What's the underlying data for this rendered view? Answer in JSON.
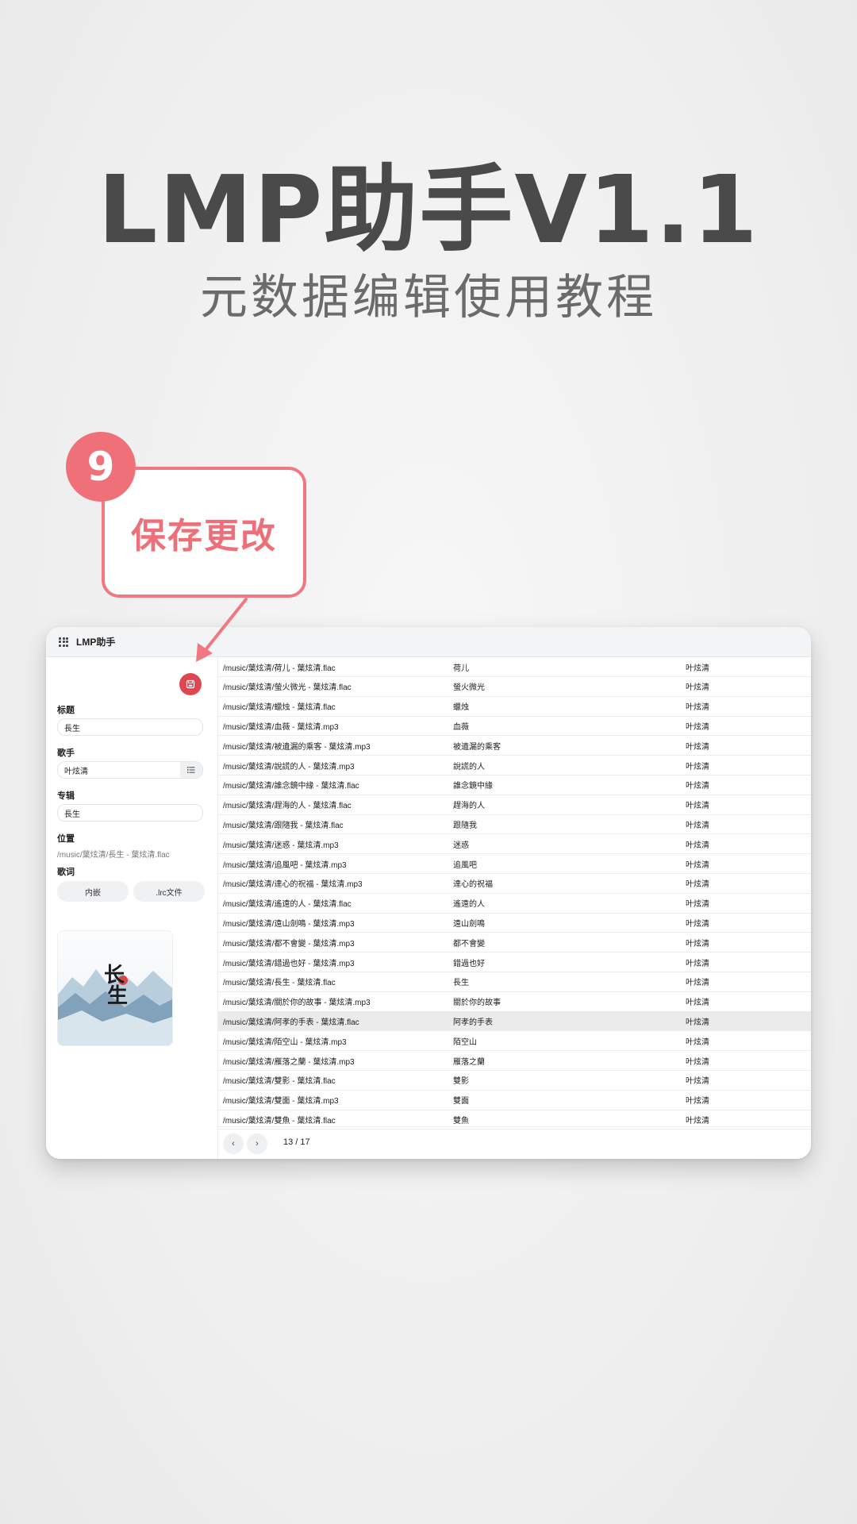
{
  "hero": {
    "title": "LMP助手V1.1",
    "subtitle": "元数据编辑使用教程"
  },
  "callout": {
    "step": "9",
    "text": "保存更改"
  },
  "app": {
    "name": "LMP助手",
    "save_icon": "save-icon"
  },
  "editor": {
    "title_label": "标题",
    "title_value": "長生",
    "artist_label": "歌手",
    "artist_value": "叶炫清",
    "album_label": "专辑",
    "album_value": "長生",
    "location_label": "位置",
    "location_value": "/music/葉炫清/長生 - 葉炫清.flac",
    "lyrics_label": "歌词",
    "lyrics_embedded": "内嵌",
    "lyrics_lrc": ".lrc文件"
  },
  "tracks": [
    {
      "path": "/music/葉炫清/荷儿 - 葉炫清.flac",
      "title": "荷儿",
      "artist": "叶炫清"
    },
    {
      "path": "/music/葉炫清/螢火微光 - 葉炫清.flac",
      "title": "螢火微光",
      "artist": "叶炫清"
    },
    {
      "path": "/music/葉炫清/蠟烛 - 葉炫清.flac",
      "title": "蠟烛",
      "artist": "叶炫清"
    },
    {
      "path": "/music/葉炫清/血薇 - 葉炫清.mp3",
      "title": "血薇",
      "artist": "叶炫清"
    },
    {
      "path": "/music/葉炫清/被遺漏的乘客 - 葉炫清.mp3",
      "title": "被遺漏的乘客",
      "artist": "叶炫清"
    },
    {
      "path": "/music/葉炫清/說謊的人 - 葉炫清.mp3",
      "title": "說謊的人",
      "artist": "叶炫清"
    },
    {
      "path": "/music/葉炫清/誰念鏡中緣 - 葉炫清.flac",
      "title": "誰念鏡中緣",
      "artist": "叶炫清"
    },
    {
      "path": "/music/葉炫清/趕海的人 - 葉炫清.flac",
      "title": "趕海的人",
      "artist": "叶炫清"
    },
    {
      "path": "/music/葉炫清/跟隨我 - 葉炫清.flac",
      "title": "跟隨我",
      "artist": "叶炫清"
    },
    {
      "path": "/music/葉炫清/迷惑 - 葉炫清.mp3",
      "title": "迷惑",
      "artist": "叶炫清"
    },
    {
      "path": "/music/葉炫清/追風吧 - 葉炫清.mp3",
      "title": "追風吧",
      "artist": "叶炫清"
    },
    {
      "path": "/music/葉炫清/達心的祝福 - 葉炫清.mp3",
      "title": "達心的祝福",
      "artist": "叶炫清"
    },
    {
      "path": "/music/葉炫清/遙遠的人 - 葉炫清.flac",
      "title": "遙遠的人",
      "artist": "叶炫清"
    },
    {
      "path": "/music/葉炫清/遠山劍鳴 - 葉炫清.mp3",
      "title": "遠山劍鳴",
      "artist": "叶炫清"
    },
    {
      "path": "/music/葉炫清/都不會變 - 葉炫清.mp3",
      "title": "都不會變",
      "artist": "叶炫清"
    },
    {
      "path": "/music/葉炫清/錯過也好 - 葉炫清.mp3",
      "title": "錯過也好",
      "artist": "叶炫清"
    },
    {
      "path": "/music/葉炫清/長生 - 葉炫清.flac",
      "title": "長生",
      "artist": "叶炫清"
    },
    {
      "path": "/music/葉炫清/關於你的故事 - 葉炫清.mp3",
      "title": "關於你的故事",
      "artist": "叶炫清"
    },
    {
      "path": "/music/葉炫清/阿孝的手表 - 葉炫清.flac",
      "title": "阿孝的手表",
      "artist": "叶炫清"
    },
    {
      "path": "/music/葉炫清/陌空山 - 葉炫清.mp3",
      "title": "陌空山",
      "artist": "叶炫清"
    },
    {
      "path": "/music/葉炫清/雁落之蘭 - 葉炫清.mp3",
      "title": "雁落之蘭",
      "artist": "叶炫清"
    },
    {
      "path": "/music/葉炫清/雙影 - 葉炫清.flac",
      "title": "雙影",
      "artist": "叶炫清"
    },
    {
      "path": "/music/葉炫清/雙面 - 葉炫清.mp3",
      "title": "雙面",
      "artist": "叶炫清"
    },
    {
      "path": "/music/葉炫清/雙魚 - 葉炫清.flac",
      "title": "雙魚",
      "artist": "叶炫清"
    }
  ],
  "active_row": 18,
  "pagination": {
    "prev_icon": "chevron-left-icon",
    "next_icon": "chevron-right-icon",
    "text": "13 / 17"
  },
  "colors": {
    "accent": "#f0707a",
    "save_button": "#e0464f"
  }
}
